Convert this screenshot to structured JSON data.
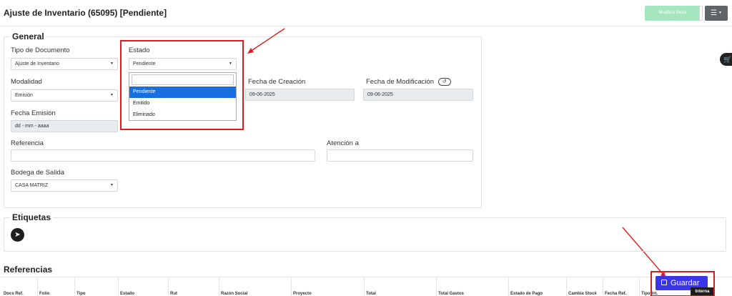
{
  "header": {
    "title": "Ajuste de Inventario (65095) [Pendiente]",
    "stock_button": "Modifica Stock",
    "menu_icon": "hamburger-icon"
  },
  "general": {
    "legend": "General",
    "tipo_documento": {
      "label": "Tipo de Documento",
      "value": "Ajuste de Inventario"
    },
    "estado": {
      "label": "Estado",
      "value": "Pendiente",
      "options": [
        "Pendiente",
        "Emitido",
        "Eliminado"
      ],
      "selected_option": "Pendiente",
      "search_value": ""
    },
    "modalidad": {
      "label": "Modalidad",
      "value": "Emisión"
    },
    "fecha_creacion": {
      "label": "Fecha de Creación",
      "value": "09-06-2025"
    },
    "fecha_modificacion": {
      "label": "Fecha de Modificación",
      "value": "09-06-2025"
    },
    "fecha_emision": {
      "label": "Fecha Emisión",
      "placeholder": "dd - mm - aaaa"
    },
    "referencia": {
      "label": "Referencia",
      "value": ""
    },
    "atencion": {
      "label": "Atención a",
      "value": ""
    },
    "bodega": {
      "label": "Bodega de Salida",
      "value": "CASA MATRIZ"
    }
  },
  "etiquetas": {
    "legend": "Etiquetas",
    "icon": "tag-add-icon"
  },
  "referencias": {
    "title": "Referencias",
    "columns": [
      "Docs Ref.",
      "Folio",
      "Tipo",
      "Estado",
      "Rut",
      "Razón Social",
      "Proyecto",
      "Total",
      "Total Gastos",
      "Estado de Pago",
      "Cambia Stock",
      "Fecha Ref.",
      "Tipo Int."
    ]
  },
  "actions": {
    "save_label": "Guardar",
    "interna_label": "Interna"
  },
  "colors": {
    "accent_button": "#3a35e8",
    "stock_button": "#a5e6bf",
    "highlight_selection": "#1a6fe0",
    "annotation_red": "#e21b1b"
  }
}
